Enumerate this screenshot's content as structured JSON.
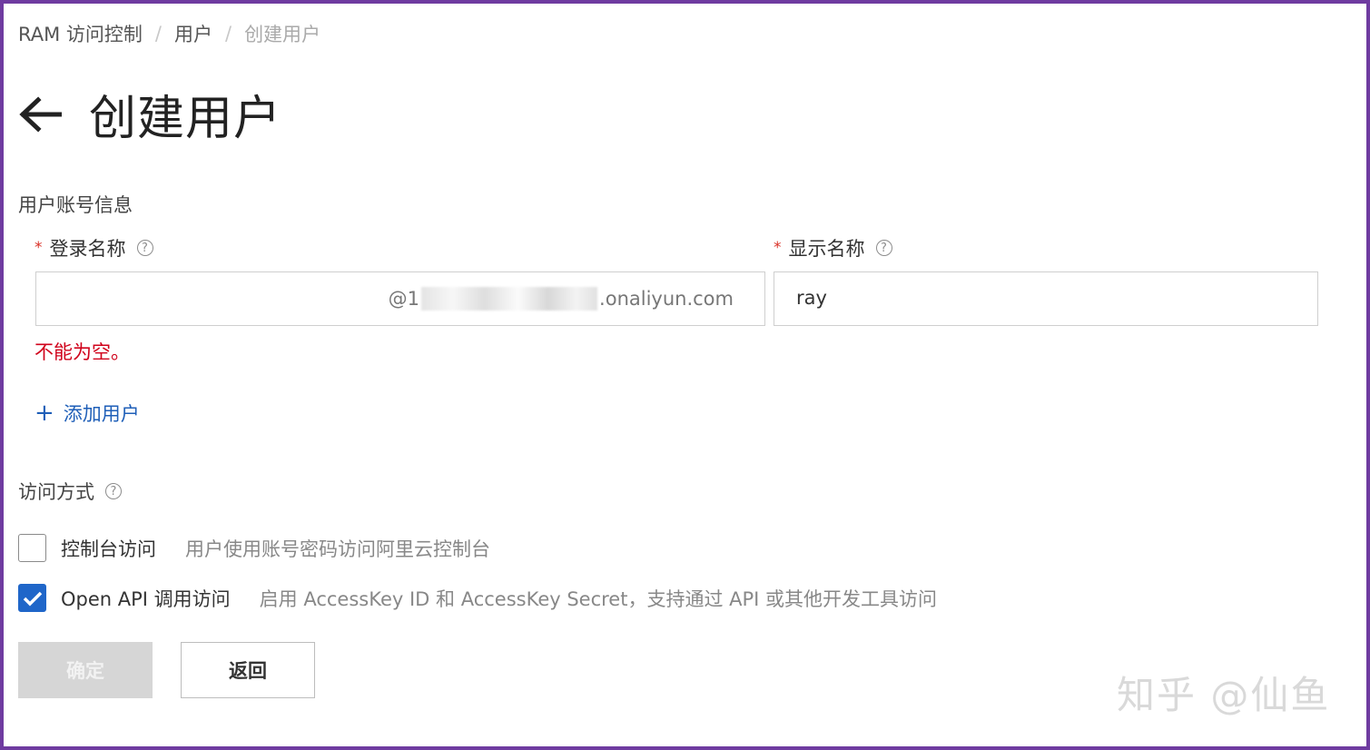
{
  "breadcrumb": {
    "items": [
      "RAM 访问控制",
      "用户",
      "创建用户"
    ],
    "separator": "/"
  },
  "header": {
    "title": "创建用户"
  },
  "section_account": {
    "title": "用户账号信息"
  },
  "login_name": {
    "label": "登录名称",
    "required_mark": "*",
    "value": "",
    "suffix_start": "@1",
    "suffix_end": ".onaliyun.com",
    "error": "不能为空。"
  },
  "display_name": {
    "label": "显示名称",
    "required_mark": "*",
    "value": "ray"
  },
  "add_user": {
    "icon": "plus-icon",
    "label": "添加用户"
  },
  "section_access": {
    "title": "访问方式"
  },
  "console_access": {
    "label": "控制台访问",
    "description": "用户使用账号密码访问阿里云控制台",
    "checked": false
  },
  "api_access": {
    "label": "Open API 调用访问",
    "description": "启用 AccessKey ID 和 AccessKey Secret，支持通过 API 或其他开发工具访问",
    "checked": true
  },
  "buttons": {
    "confirm": "确定",
    "back": "返回"
  },
  "watermark": "知乎 @仙鱼",
  "colors": {
    "frame": "#6f3ba0",
    "error": "#d0021b",
    "link": "#1f5fb8",
    "checkbox_checked": "#1f66c9",
    "disabled_button": "#d6d6d6"
  }
}
